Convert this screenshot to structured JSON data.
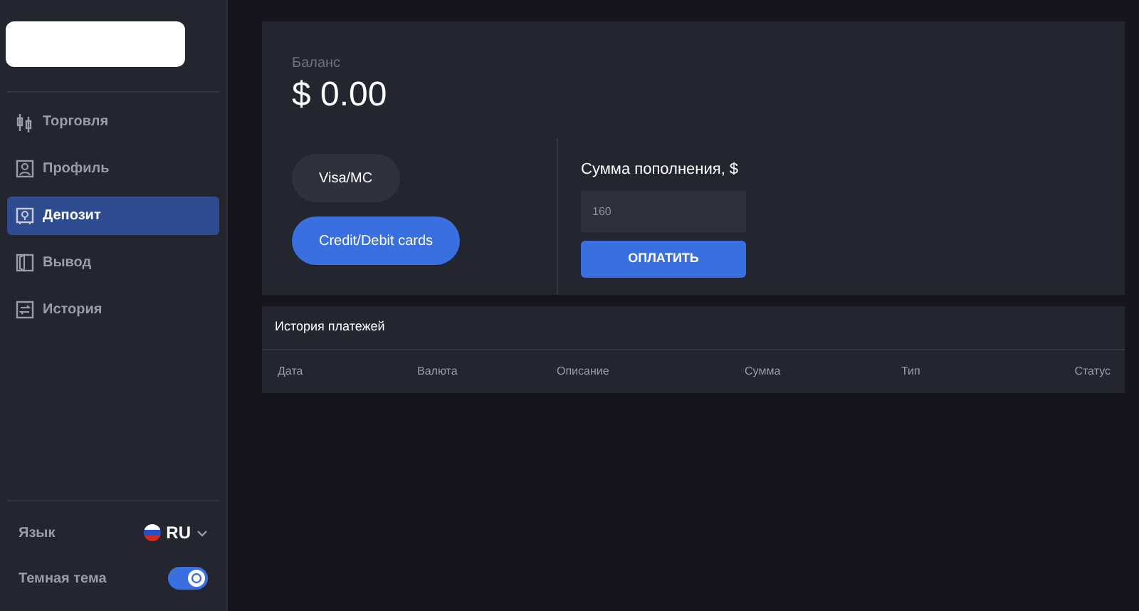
{
  "sidebar": {
    "items": [
      {
        "label": "Торговля",
        "selected": false
      },
      {
        "label": "Профиль",
        "selected": false
      },
      {
        "label": "Депозит",
        "selected": true
      },
      {
        "label": "Вывод",
        "selected": false
      },
      {
        "label": "История",
        "selected": false
      }
    ],
    "language": {
      "label": "Язык",
      "value": "RU"
    },
    "dark_theme": {
      "label": "Темная тема",
      "on": true
    }
  },
  "balance": {
    "label": "Баланс",
    "value": "$ 0.00"
  },
  "methods": [
    {
      "label": "Visa/MC",
      "selected": false
    },
    {
      "label": "Credit/Debit cards",
      "selected": true
    }
  ],
  "amount": {
    "label": "Сумма пополнения, $",
    "placeholder": "160",
    "button": "ОПЛАТИТЬ"
  },
  "history": {
    "title": "История платежей",
    "columns": [
      "Дата",
      "Валюта",
      "Описание",
      "Сумма",
      "Тип",
      "Статус"
    ]
  }
}
